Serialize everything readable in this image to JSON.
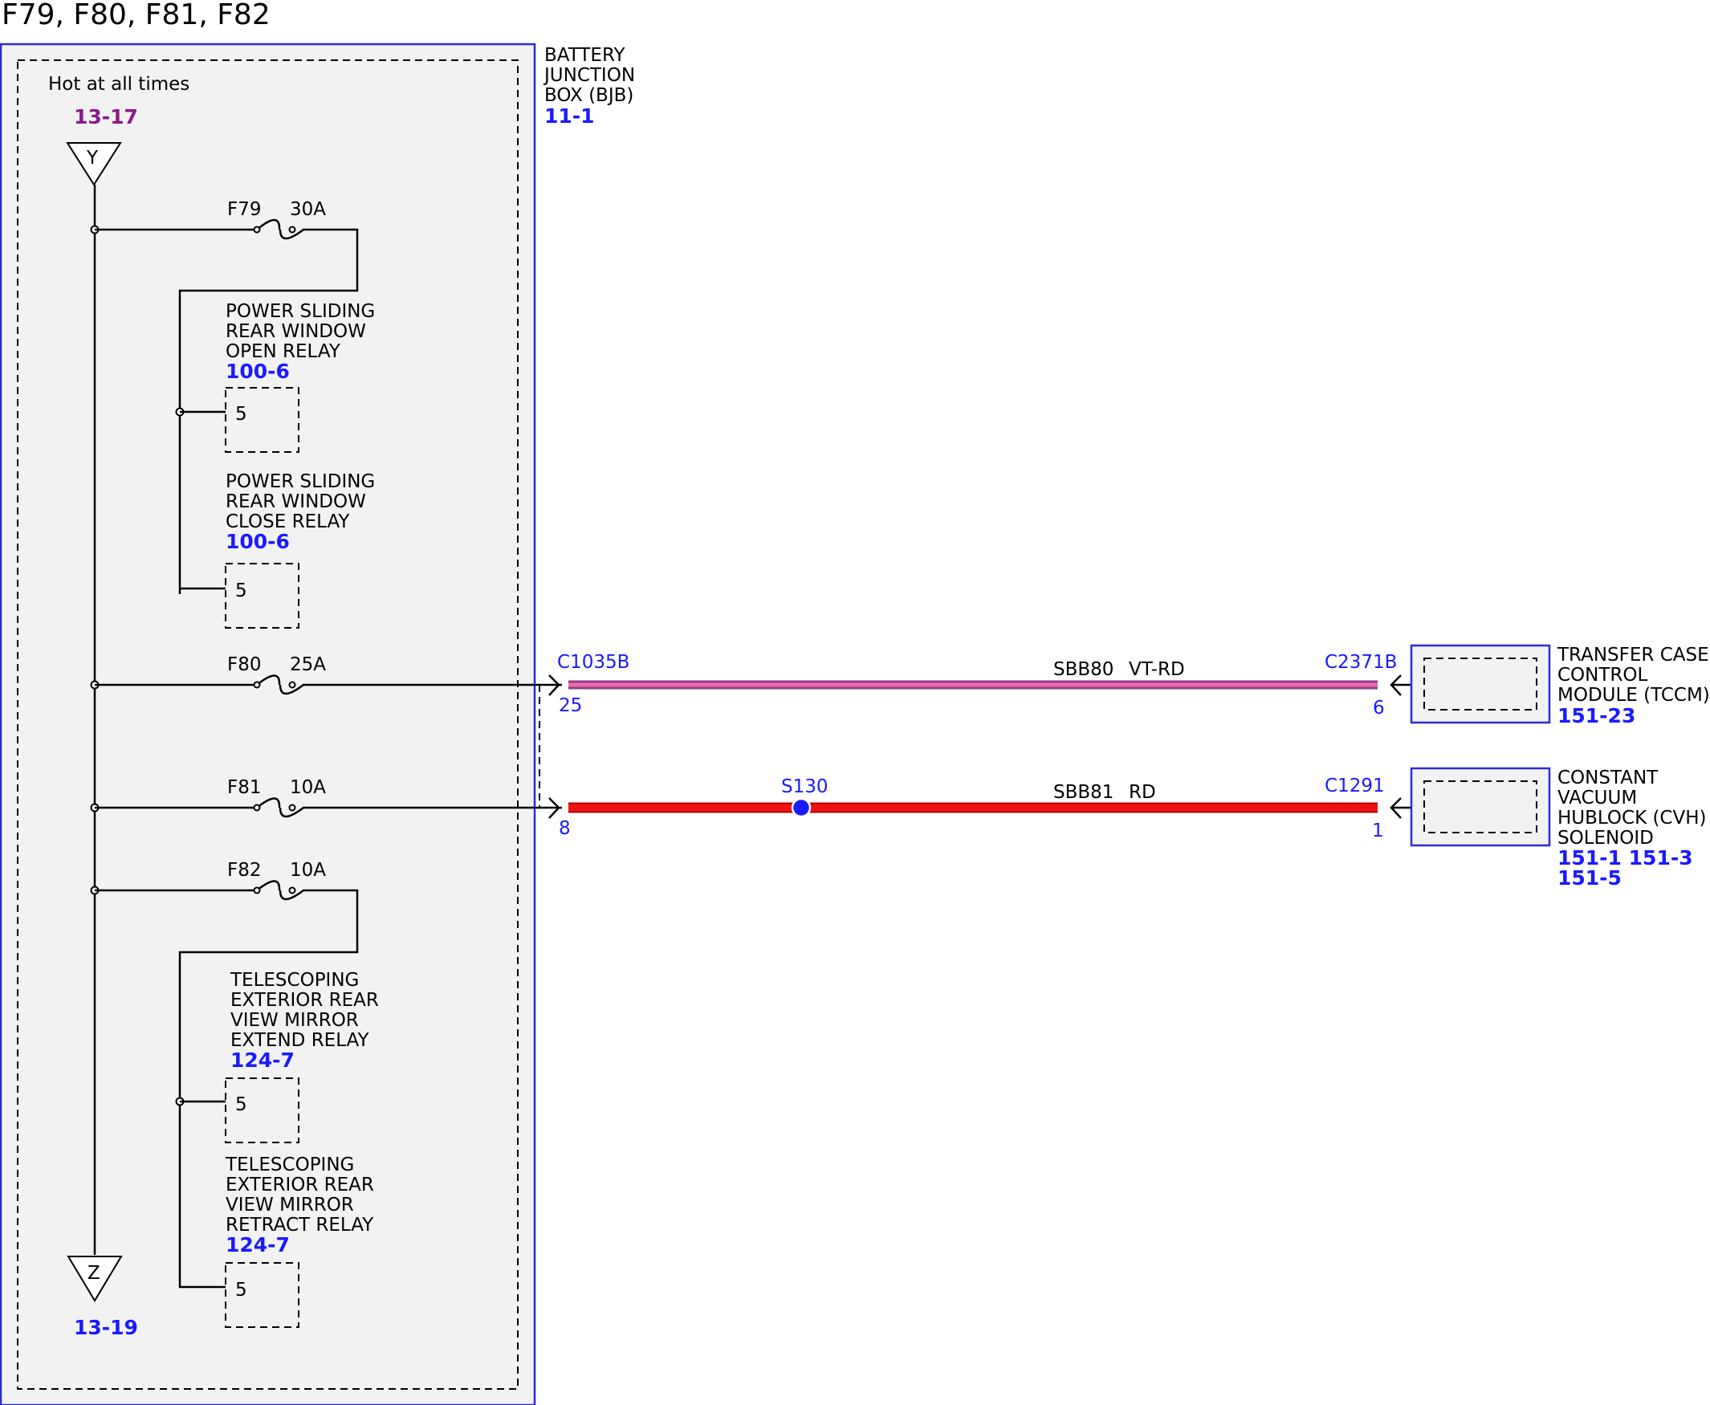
{
  "page_title": "F79, F80, F81, F82",
  "colors": {
    "box_border": "#2b2bd9",
    "box_fill": "#f2f2f2",
    "wire_black": "#000000",
    "wire_violet_red": "#e0609a",
    "wire_red": "#ee1111",
    "ref_blue": "#1a1aff",
    "ref_purple": "#8b1a8b"
  },
  "bjb": {
    "label_lines": [
      "BATTERY",
      "JUNCTION",
      "BOX (BJB)"
    ],
    "ref": "11-1",
    "hot_label": "Hot at all times",
    "source_ref": "13-17",
    "source_symbol": "Y",
    "end_symbol": "Z",
    "end_ref": "13-19"
  },
  "fuses": [
    {
      "id": "F79",
      "rating": "30A"
    },
    {
      "id": "F80",
      "rating": "25A"
    },
    {
      "id": "F81",
      "rating": "10A"
    },
    {
      "id": "F82",
      "rating": "10A"
    }
  ],
  "relays": [
    {
      "lines": [
        "POWER SLIDING",
        "REAR WINDOW",
        "OPEN RELAY"
      ],
      "ref": "100-6",
      "pin": "5"
    },
    {
      "lines": [
        "POWER SLIDING",
        "REAR WINDOW",
        "CLOSE RELAY"
      ],
      "ref": "100-6",
      "pin": "5"
    },
    {
      "lines": [
        "TELESCOPING",
        "EXTERIOR REAR",
        "VIEW MIRROR",
        "EXTEND RELAY"
      ],
      "ref": "124-7",
      "pin": "5"
    },
    {
      "lines": [
        "TELESCOPING",
        "EXTERIOR REAR",
        "VIEW MIRROR",
        "RETRACT RELAY"
      ],
      "ref": "124-7",
      "pin": "5"
    }
  ],
  "circuits": [
    {
      "from_connector": "C1035B",
      "from_pin": "25",
      "circuit": "SBB80",
      "color_code": "VT-RD",
      "to_connector": "C2371B",
      "to_pin": "6",
      "component_lines": [
        "TRANSFER CASE",
        "CONTROL",
        "MODULE (TCCM)"
      ],
      "component_refs": [
        "151-23"
      ]
    },
    {
      "from_connector": "",
      "from_pin": "8",
      "circuit": "SBB81",
      "color_code": "RD",
      "splice": "S130",
      "to_connector": "C1291",
      "to_pin": "1",
      "component_lines": [
        "CONSTANT",
        "VACUUM",
        "HUBLOCK (CVH)",
        "SOLENOID"
      ],
      "component_refs": [
        "151-1 151-3",
        "151-5"
      ]
    }
  ]
}
